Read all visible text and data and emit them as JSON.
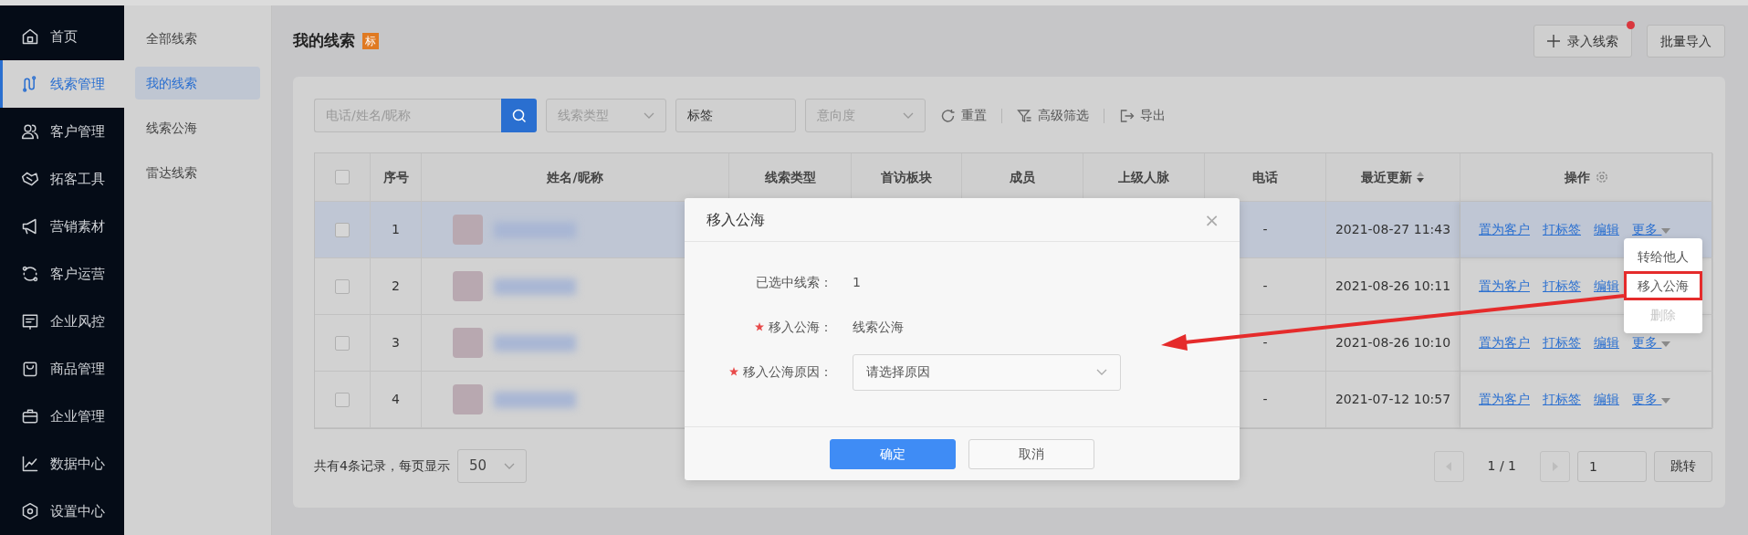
{
  "sidebar": {
    "items": [
      {
        "label": "首页",
        "selected": false
      },
      {
        "label": "线索管理",
        "selected": true
      },
      {
        "label": "客户管理",
        "selected": false
      },
      {
        "label": "拓客工具",
        "selected": false
      },
      {
        "label": "营销素材",
        "selected": false
      },
      {
        "label": "客户运营",
        "selected": false
      },
      {
        "label": "企业风控",
        "selected": false
      },
      {
        "label": "商品管理",
        "selected": false
      },
      {
        "label": "企业管理",
        "selected": false
      },
      {
        "label": "数据中心",
        "selected": false
      },
      {
        "label": "设置中心",
        "selected": false
      }
    ]
  },
  "submenu": {
    "items": [
      {
        "label": "全部线索",
        "selected": false
      },
      {
        "label": "我的线索",
        "selected": true
      },
      {
        "label": "线索公海",
        "selected": false
      },
      {
        "label": "雷达线索",
        "selected": false
      }
    ]
  },
  "page": {
    "title": "我的线索",
    "badge": "标",
    "buttons": [
      {
        "label": "录入线索",
        "kind": "add",
        "dot": true
      },
      {
        "label": "批量导入",
        "kind": "plain",
        "dot": false
      }
    ]
  },
  "filters": {
    "search": {
      "placeholder": "电话/姓名/昵称"
    },
    "fields": [
      {
        "kind": "select",
        "placeholder": "线索类型"
      },
      {
        "kind": "input",
        "value": "标签"
      },
      {
        "kind": "select",
        "placeholder": "意向度"
      }
    ],
    "actions": [
      {
        "kind": "reset",
        "label": "重置"
      },
      {
        "kind": "filter",
        "label": "高级筛选"
      },
      {
        "kind": "export",
        "label": "导出"
      }
    ]
  },
  "table": {
    "header_checked": false,
    "columns": [
      {
        "kind": "check"
      },
      {
        "label": "序号",
        "kind": "text"
      },
      {
        "label": "姓名/昵称",
        "kind": "text"
      },
      {
        "label": "线索类型",
        "kind": "text"
      },
      {
        "label": "首访板块",
        "kind": "text"
      },
      {
        "label": "成员",
        "kind": "text"
      },
      {
        "label": "上级人脉",
        "kind": "text"
      },
      {
        "label": "电话",
        "kind": "text"
      },
      {
        "label": "最近更新",
        "kind": "sort"
      },
      {
        "label": "操作",
        "kind": "settings"
      }
    ],
    "rows": [
      {
        "index": "1",
        "checked": false,
        "selected": true,
        "phone": "-",
        "updated": "2021-08-27 11:43",
        "actions": [
          "置为客户",
          "打标签",
          "编辑"
        ],
        "more": "更多"
      },
      {
        "index": "2",
        "checked": false,
        "selected": false,
        "phone": "-",
        "updated": "2021-08-26 10:11",
        "actions": [
          "置为客户",
          "打标签",
          "编辑"
        ]
      },
      {
        "index": "3",
        "checked": false,
        "selected": false,
        "phone": "-",
        "updated": "2021-08-26 10:10",
        "actions": [
          "置为客户",
          "打标签",
          "编辑"
        ],
        "more": "更多"
      },
      {
        "index": "4",
        "checked": false,
        "selected": false,
        "phone": "-",
        "updated": "2021-07-12 10:57",
        "actions": [
          "置为客户",
          "打标签",
          "编辑"
        ],
        "more": "更多"
      }
    ]
  },
  "footer": {
    "summary": "共有4条记录，每页显示",
    "page_size": "50",
    "pagination": {
      "prev_disabled": true,
      "page": "1 / 1",
      "next_disabled": true,
      "jump_value": "1",
      "jump_label": "跳转"
    }
  },
  "more_menu": {
    "items": [
      {
        "label": "转给他人",
        "disabled": false,
        "highlighted": false
      },
      {
        "label": "移入公海",
        "disabled": false,
        "highlighted": true
      },
      {
        "label": "删除",
        "disabled": true,
        "highlighted": false
      }
    ]
  },
  "modal": {
    "title": "移入公海",
    "close": "×",
    "fields": [
      {
        "kind": "text",
        "label": "已选中线索：",
        "required": false,
        "value": "1"
      },
      {
        "kind": "text",
        "label": "移入公海：",
        "required": true,
        "value": "线索公海"
      },
      {
        "kind": "select",
        "label": "移入公海原因：",
        "required": true,
        "placeholder": "请选择原因"
      }
    ],
    "buttons": [
      {
        "label": "确定",
        "kind": "primary"
      },
      {
        "label": "取消",
        "kind": "secondary"
      }
    ]
  }
}
